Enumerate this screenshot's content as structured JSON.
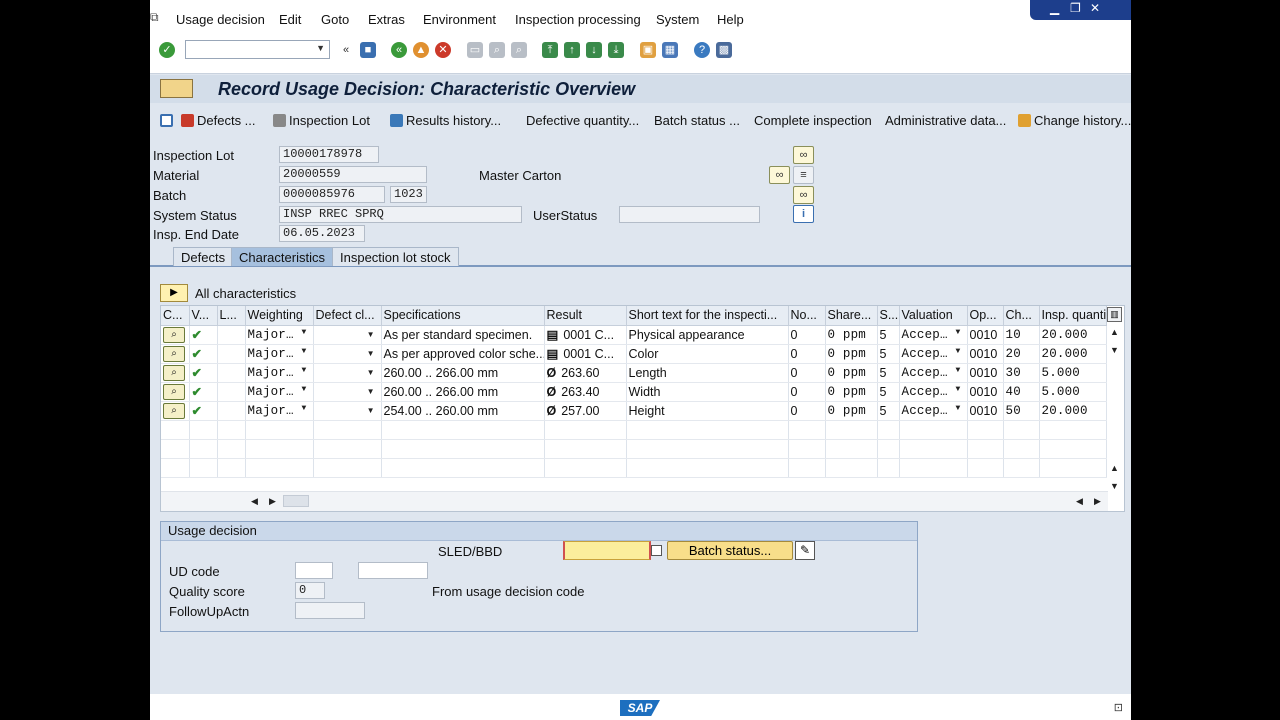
{
  "menu": {
    "items": [
      "Usage decision",
      "Edit",
      "Goto",
      "Extras",
      "Environment",
      "Inspection processing",
      "System",
      "Help"
    ]
  },
  "window_controls": {
    "minimize": "▁",
    "restore": "❐",
    "close": "✕"
  },
  "title": "Record Usage Decision: Characteristic Overview",
  "app_toolbar": {
    "defects": "Defects ...",
    "inspection_lot": "Inspection Lot",
    "results_history": "Results history...",
    "defective_quantity": "Defective quantity...",
    "batch_status": "Batch status ...",
    "complete_inspection": "Complete inspection",
    "administrative_data": "Administrative data...",
    "change_history": "Change history..."
  },
  "header": {
    "inspection_lot_label": "Inspection Lot",
    "inspection_lot": "10000178978",
    "material_label": "Material",
    "material": "20000559",
    "material_desc": "Master Carton",
    "batch_label": "Batch",
    "batch": "0000085976",
    "plant": "1023",
    "system_status_label": "System Status",
    "system_status": "INSP RREC SPRQ",
    "user_status_label": "UserStatus",
    "user_status": "",
    "insp_end_date_label": "Insp. End Date",
    "insp_end_date": "06.05.2023"
  },
  "tabs": [
    "Defects",
    "Characteristics",
    "Inspection lot stock"
  ],
  "table": {
    "filter_label": "All characteristics",
    "columns": [
      "C...",
      "V...",
      "L...",
      "Weighting",
      "Defect cl...",
      "Specifications",
      "Result",
      "Short text for the inspecti...",
      "No...",
      "Share...",
      "S...",
      "Valuation",
      "Op...",
      "Ch...",
      "Insp. quanti"
    ],
    "rows": [
      {
        "weighting": "Major…",
        "spec": "As per standard specimen.",
        "result_sym": "▤",
        "result": "0001 C...",
        "short_text": "Physical appearance",
        "no": "0",
        "share": "0 ppm",
        "s": "5",
        "valuation": "Accep…",
        "op": "0010",
        "ch": "10",
        "qty": "20.000"
      },
      {
        "weighting": "Major…",
        "spec": "As per approved color sche...",
        "result_sym": "▤",
        "result": "0001 C...",
        "short_text": "Color",
        "no": "0",
        "share": "0 ppm",
        "s": "5",
        "valuation": "Accep…",
        "op": "0010",
        "ch": "20",
        "qty": "20.000"
      },
      {
        "weighting": "Major…",
        "spec": "260.00 .. 266.00 mm",
        "result_sym": "Ø",
        "result": "263.60",
        "short_text": "Length",
        "no": "0",
        "share": "0 ppm",
        "s": "5",
        "valuation": "Accep…",
        "op": "0010",
        "ch": "30",
        "qty": "5.000"
      },
      {
        "weighting": "Major…",
        "spec": "260.00 .. 266.00 mm",
        "result_sym": "Ø",
        "result": "263.40",
        "short_text": "Width",
        "no": "0",
        "share": "0 ppm",
        "s": "5",
        "valuation": "Accep…",
        "op": "0010",
        "ch": "40",
        "qty": "5.000"
      },
      {
        "weighting": "Major…",
        "spec": "254.00 .. 260.00 mm",
        "result_sym": "Ø",
        "result": "257.00",
        "short_text": "Height",
        "no": "0",
        "share": "0 ppm",
        "s": "5",
        "valuation": "Accep…",
        "op": "0010",
        "ch": "50",
        "qty": "20.000"
      }
    ]
  },
  "usage_decision": {
    "title": "Usage decision",
    "sled_label": "SLED/BBD",
    "sled_value": "",
    "batch_status_button": "Batch status...",
    "ud_code_label": "UD code",
    "ud_code": "",
    "ud_code_text": "",
    "quality_score_label": "Quality score",
    "quality_score": "0",
    "quality_score_note": "From usage decision code",
    "followup_label": "FollowUpActn",
    "followup": ""
  },
  "footer": {
    "logo": "SAP"
  },
  "colors": {
    "accent": "#1d3e8c",
    "active_tab": "#a6c0de",
    "ok_green": "#2e8b2e",
    "button_yellow": "#f8de8a"
  }
}
